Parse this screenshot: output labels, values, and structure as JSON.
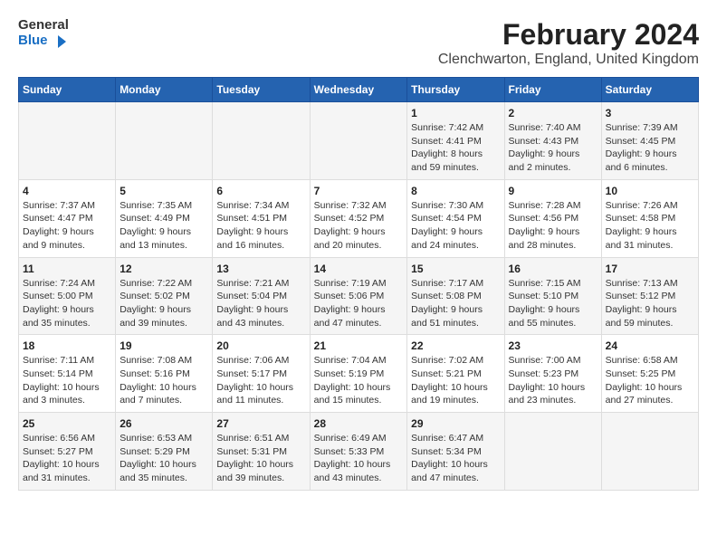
{
  "logo": {
    "text_general": "General",
    "text_blue": "Blue"
  },
  "title": "February 2024",
  "subtitle": "Clenchwarton, England, United Kingdom",
  "days_of_week": [
    "Sunday",
    "Monday",
    "Tuesday",
    "Wednesday",
    "Thursday",
    "Friday",
    "Saturday"
  ],
  "weeks": [
    [
      {
        "day": "",
        "info": ""
      },
      {
        "day": "",
        "info": ""
      },
      {
        "day": "",
        "info": ""
      },
      {
        "day": "",
        "info": ""
      },
      {
        "day": "1",
        "info": "Sunrise: 7:42 AM\nSunset: 4:41 PM\nDaylight: 8 hours and 59 minutes."
      },
      {
        "day": "2",
        "info": "Sunrise: 7:40 AM\nSunset: 4:43 PM\nDaylight: 9 hours and 2 minutes."
      },
      {
        "day": "3",
        "info": "Sunrise: 7:39 AM\nSunset: 4:45 PM\nDaylight: 9 hours and 6 minutes."
      }
    ],
    [
      {
        "day": "4",
        "info": "Sunrise: 7:37 AM\nSunset: 4:47 PM\nDaylight: 9 hours and 9 minutes."
      },
      {
        "day": "5",
        "info": "Sunrise: 7:35 AM\nSunset: 4:49 PM\nDaylight: 9 hours and 13 minutes."
      },
      {
        "day": "6",
        "info": "Sunrise: 7:34 AM\nSunset: 4:51 PM\nDaylight: 9 hours and 16 minutes."
      },
      {
        "day": "7",
        "info": "Sunrise: 7:32 AM\nSunset: 4:52 PM\nDaylight: 9 hours and 20 minutes."
      },
      {
        "day": "8",
        "info": "Sunrise: 7:30 AM\nSunset: 4:54 PM\nDaylight: 9 hours and 24 minutes."
      },
      {
        "day": "9",
        "info": "Sunrise: 7:28 AM\nSunset: 4:56 PM\nDaylight: 9 hours and 28 minutes."
      },
      {
        "day": "10",
        "info": "Sunrise: 7:26 AM\nSunset: 4:58 PM\nDaylight: 9 hours and 31 minutes."
      }
    ],
    [
      {
        "day": "11",
        "info": "Sunrise: 7:24 AM\nSunset: 5:00 PM\nDaylight: 9 hours and 35 minutes."
      },
      {
        "day": "12",
        "info": "Sunrise: 7:22 AM\nSunset: 5:02 PM\nDaylight: 9 hours and 39 minutes."
      },
      {
        "day": "13",
        "info": "Sunrise: 7:21 AM\nSunset: 5:04 PM\nDaylight: 9 hours and 43 minutes."
      },
      {
        "day": "14",
        "info": "Sunrise: 7:19 AM\nSunset: 5:06 PM\nDaylight: 9 hours and 47 minutes."
      },
      {
        "day": "15",
        "info": "Sunrise: 7:17 AM\nSunset: 5:08 PM\nDaylight: 9 hours and 51 minutes."
      },
      {
        "day": "16",
        "info": "Sunrise: 7:15 AM\nSunset: 5:10 PM\nDaylight: 9 hours and 55 minutes."
      },
      {
        "day": "17",
        "info": "Sunrise: 7:13 AM\nSunset: 5:12 PM\nDaylight: 9 hours and 59 minutes."
      }
    ],
    [
      {
        "day": "18",
        "info": "Sunrise: 7:11 AM\nSunset: 5:14 PM\nDaylight: 10 hours and 3 minutes."
      },
      {
        "day": "19",
        "info": "Sunrise: 7:08 AM\nSunset: 5:16 PM\nDaylight: 10 hours and 7 minutes."
      },
      {
        "day": "20",
        "info": "Sunrise: 7:06 AM\nSunset: 5:17 PM\nDaylight: 10 hours and 11 minutes."
      },
      {
        "day": "21",
        "info": "Sunrise: 7:04 AM\nSunset: 5:19 PM\nDaylight: 10 hours and 15 minutes."
      },
      {
        "day": "22",
        "info": "Sunrise: 7:02 AM\nSunset: 5:21 PM\nDaylight: 10 hours and 19 minutes."
      },
      {
        "day": "23",
        "info": "Sunrise: 7:00 AM\nSunset: 5:23 PM\nDaylight: 10 hours and 23 minutes."
      },
      {
        "day": "24",
        "info": "Sunrise: 6:58 AM\nSunset: 5:25 PM\nDaylight: 10 hours and 27 minutes."
      }
    ],
    [
      {
        "day": "25",
        "info": "Sunrise: 6:56 AM\nSunset: 5:27 PM\nDaylight: 10 hours and 31 minutes."
      },
      {
        "day": "26",
        "info": "Sunrise: 6:53 AM\nSunset: 5:29 PM\nDaylight: 10 hours and 35 minutes."
      },
      {
        "day": "27",
        "info": "Sunrise: 6:51 AM\nSunset: 5:31 PM\nDaylight: 10 hours and 39 minutes."
      },
      {
        "day": "28",
        "info": "Sunrise: 6:49 AM\nSunset: 5:33 PM\nDaylight: 10 hours and 43 minutes."
      },
      {
        "day": "29",
        "info": "Sunrise: 6:47 AM\nSunset: 5:34 PM\nDaylight: 10 hours and 47 minutes."
      },
      {
        "day": "",
        "info": ""
      },
      {
        "day": "",
        "info": ""
      }
    ]
  ]
}
